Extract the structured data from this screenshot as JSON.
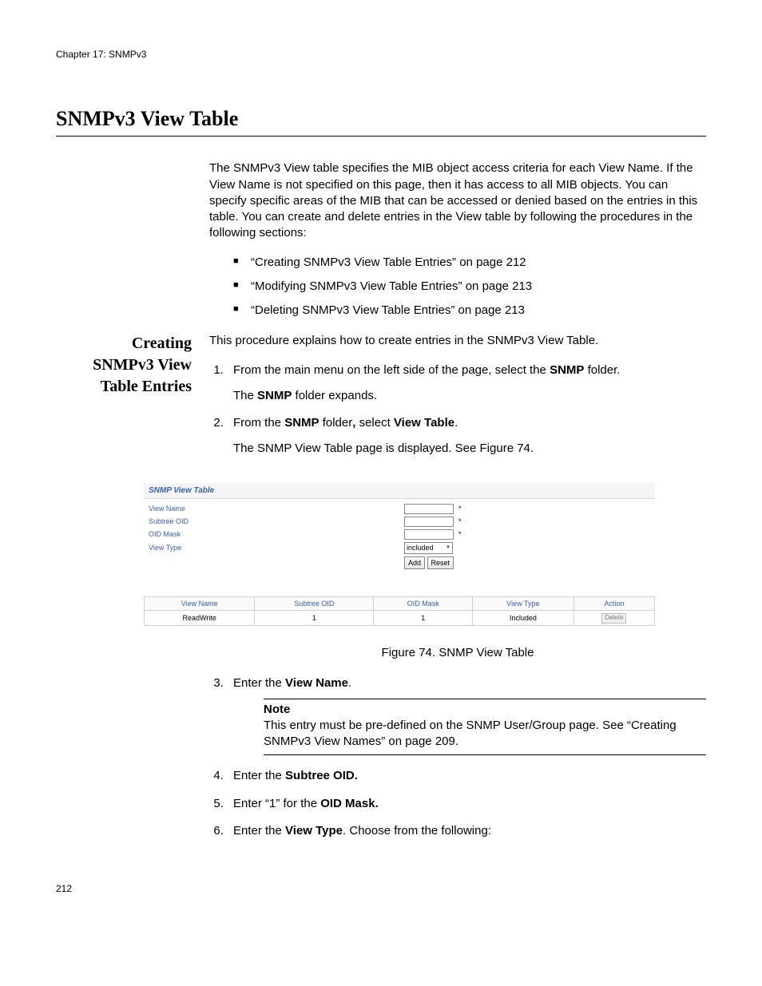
{
  "header": {
    "chapter": "Chapter 17: SNMPv3"
  },
  "title": "SNMPv3 View Table",
  "intro": "The SNMPv3 View table specifies the MIB object access criteria for each View Name. If the View Name is not specified on this page, then it has access to all MIB objects. You can specify specific areas of the MIB that can be accessed or denied based on the entries in this table. You can create and delete entries in the View table by following the procedures in the following sections:",
  "bullets": [
    "“Creating SNMPv3 View Table Entries” on page 212",
    "“Modifying SNMPv3 View Table Entries” on page 213",
    "“Deleting SNMPv3 View Table Entries” on page 213"
  ],
  "sidebar": {
    "heading_l1": "Creating",
    "heading_l2": "SNMPv3 View",
    "heading_l3": "Table Entries"
  },
  "section": {
    "lead": "This procedure explains how to create entries in the SNMPv3 View Table.",
    "step1_pre": "From the main menu on the left side of the page, select the ",
    "step1_bold": "SNMP",
    "step1_post": " folder.",
    "step1_result_pre": "The ",
    "step1_result_bold": "SNMP",
    "step1_result_post": " folder expands.",
    "step2_pre": "From the ",
    "step2_b1": "SNMP",
    "step2_mid": " folder",
    "step2_comma": ",",
    "step2_sel": " select ",
    "step2_b2": "View Table",
    "step2_period": ".",
    "step2_result": "The SNMP View Table page is displayed. See Figure 74.",
    "step3_pre": "Enter the ",
    "step3_bold": "View Name",
    "step3_period": ".",
    "step4_pre": "Enter the ",
    "step4_bold": "Subtree OID.",
    "step5_pre": "Enter “1” for the ",
    "step5_bold": "OID Mask.",
    "step6_pre": "Enter the ",
    "step6_bold": "View Type",
    "step6_post": ". Choose from the following:"
  },
  "figure": {
    "panel_title": "SNMP View Table",
    "labels": {
      "view_name": "View Name",
      "subtree_oid": "Subtree OID",
      "oid_mask": "OID Mask",
      "view_type": "View Type"
    },
    "select_value": "included",
    "btn_add": "Add",
    "btn_reset": "Reset",
    "cols": {
      "c1": "View Name",
      "c2": "Subtree OID",
      "c3": "OID Mask",
      "c4": "View Type",
      "c5": "Action"
    },
    "row": {
      "c1": "ReadWrite",
      "c2": "1",
      "c3": "1",
      "c4": "Included",
      "c5": "Delete"
    },
    "caption": "Figure 74. SNMP View Table"
  },
  "note": {
    "title": "Note",
    "body": "This entry must be pre-defined on the SNMP User/Group page. See “Creating SNMPv3 View Names” on page 209."
  },
  "page_number": "212"
}
